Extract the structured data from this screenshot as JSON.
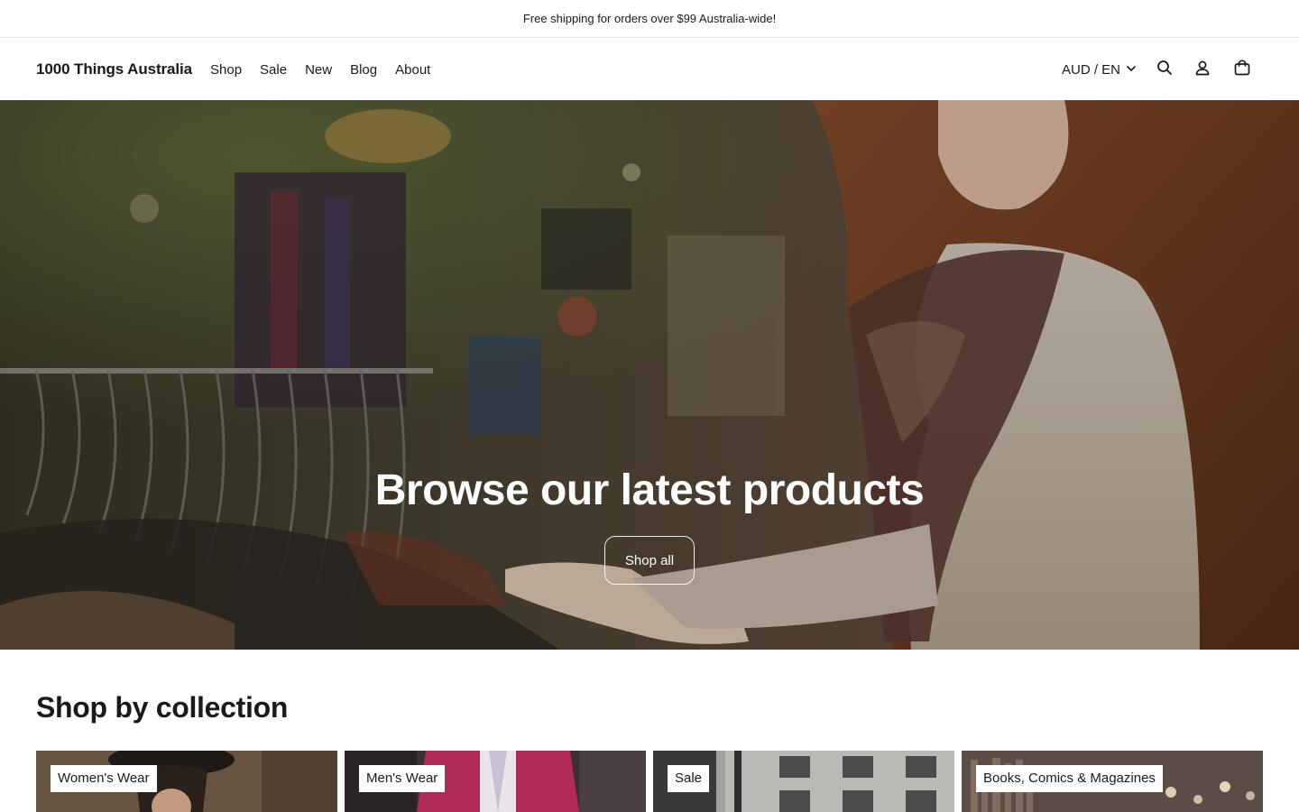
{
  "announcement": {
    "text": "Free shipping for orders over $99 Australia-wide!"
  },
  "header": {
    "logo": "1000 Things Australia",
    "nav": [
      {
        "label": "Shop"
      },
      {
        "label": "Sale"
      },
      {
        "label": "New"
      },
      {
        "label": "Blog"
      },
      {
        "label": "About"
      }
    ],
    "currency": "AUD / EN",
    "icons": [
      "search-icon",
      "account-icon",
      "cart-icon",
      "chevron-down-icon"
    ]
  },
  "hero": {
    "title": "Browse our latest products",
    "button": "Shop all"
  },
  "collections": {
    "title": "Shop by collection",
    "items": [
      {
        "label": "Women's Wear"
      },
      {
        "label": "Men's Wear"
      },
      {
        "label": "Sale"
      },
      {
        "label": "Books, Comics & Magazines"
      }
    ]
  }
}
